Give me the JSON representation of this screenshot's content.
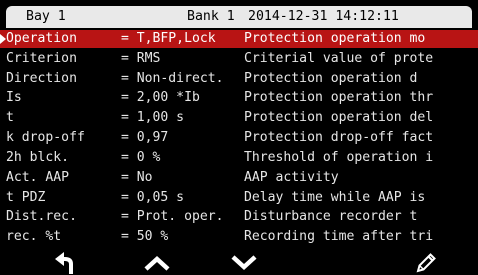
{
  "header": {
    "bay": "Bay 1",
    "bank": "Bank 1",
    "datetime": "2014-12-31 14:12:11"
  },
  "rows": [
    {
      "name": "Operation",
      "value": "= T,BFP,Lock",
      "desc": "Protection operation mo",
      "selected": true
    },
    {
      "name": "Criterion",
      "value": "= RMS",
      "desc": "Criterial value of prote"
    },
    {
      "name": "Direction",
      "value": "= Non-direct.",
      "desc": "Protection operation d"
    },
    {
      "name": "Is",
      "value": "= 2,00 *Ib",
      "desc": "Protection operation thr"
    },
    {
      "name": "t",
      "value": "= 1,00 s",
      "desc": "Protection operation del"
    },
    {
      "name": "k drop-off",
      "value": "= 0,97",
      "desc": "Protection drop-off fact"
    },
    {
      "name": "2h blck.",
      "value": "= 0 %",
      "desc": "Threshold of operation i"
    },
    {
      "name": "Act. AAP",
      "value": "= No",
      "desc": "AAP activity"
    },
    {
      "name": "t PDZ",
      "value": "= 0,05 s",
      "desc": "Delay time while AAP is"
    },
    {
      "name": "Dist.rec.",
      "value": "= Prot. oper.",
      "desc": "Disturbance recorder t"
    },
    {
      "name": "rec. %t",
      "value": "= 50 %",
      "desc": "Recording time after tri"
    }
  ],
  "footer": {
    "buttons": [
      {
        "name": "back-button",
        "icon": "back-arrow-icon"
      },
      {
        "name": "up-button",
        "icon": "chevron-up-icon"
      },
      {
        "name": "down-button",
        "icon": "chevron-down-icon"
      },
      {
        "name": "edit-button",
        "icon": "pencil-icon"
      }
    ]
  },
  "colors": {
    "selection": "#b81414",
    "header_bg": "#e9e9e9",
    "background": "#000000"
  }
}
